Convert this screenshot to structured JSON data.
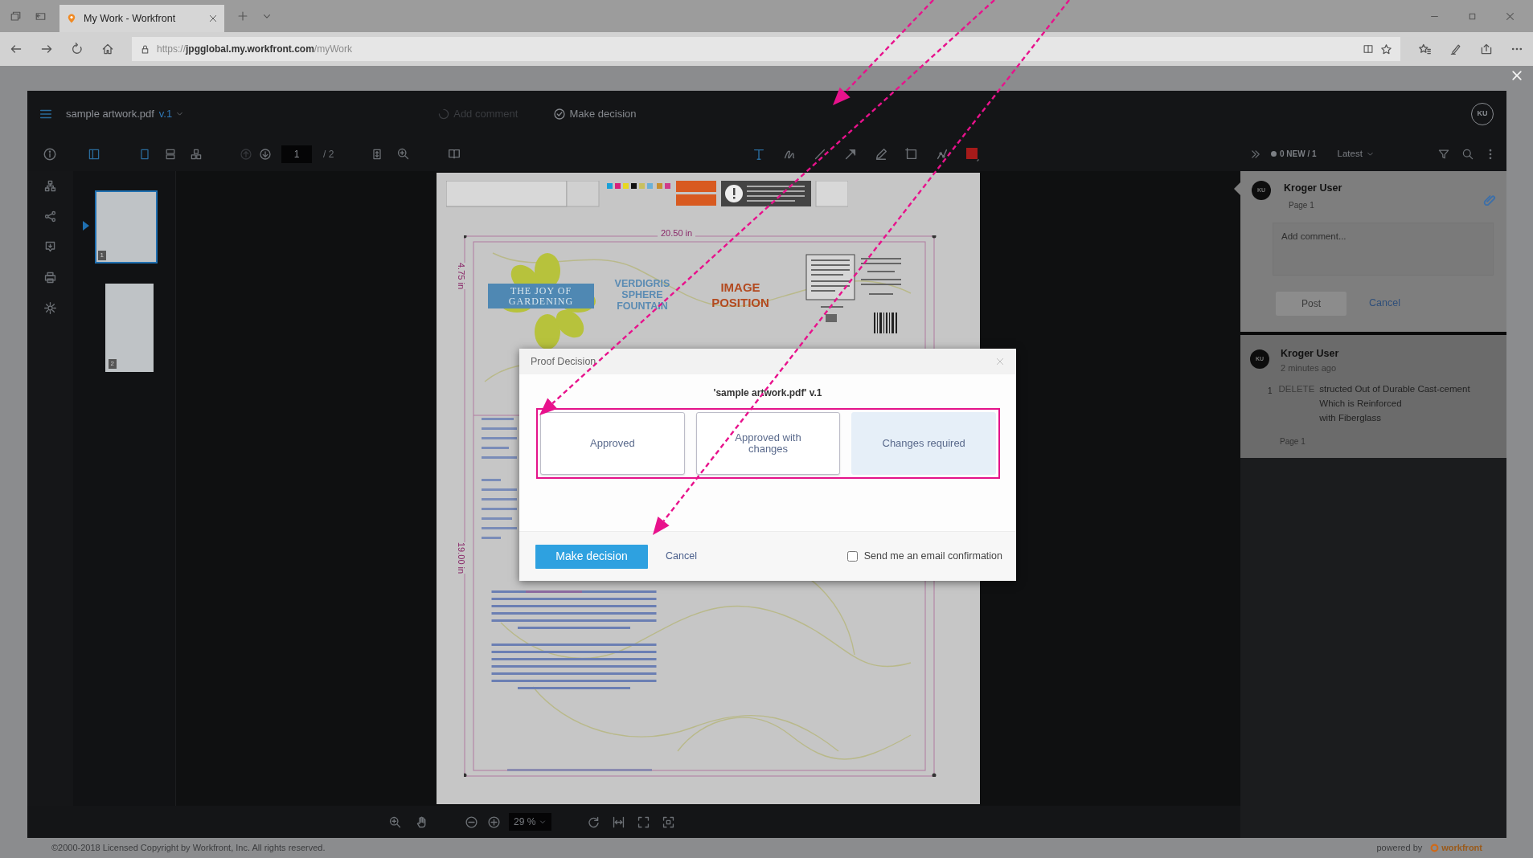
{
  "browser": {
    "tabs": [
      {
        "title": "My Work - Workfront",
        "selected": true
      }
    ],
    "address": "https://**jpgglobal.my.workfront.com**/myWork"
  },
  "viewer": {
    "file_name": "sample artwork.pdf",
    "version": "v.1",
    "header_actions": [
      {
        "kind": "add-comment",
        "label": "Add comment",
        "disabled": true
      },
      {
        "kind": "make-decision",
        "label": "Make decision",
        "disabled": false
      }
    ],
    "avatar": "KU",
    "page_input": "1",
    "page_total": "/ 2",
    "thumbnails": [
      {
        "number": "1",
        "selected": true
      },
      {
        "number": "2",
        "selected": false
      }
    ],
    "document": {
      "width_label": "20.50 in",
      "height_label": "4.75 in",
      "length_label": "19.00 in",
      "brand_lines": [
        "THE JOY OF",
        "GARDENING"
      ],
      "product_lines": [
        "VERDIGRIS",
        "SPHERE",
        "FOUNTAIN"
      ],
      "image_lines": [
        "IMAGE",
        "POSITION"
      ]
    },
    "zoom": "29 %"
  },
  "comments_panel": {
    "new_count": "0 NEW / 1",
    "sort": "Latest",
    "draft": {
      "author": "Kroger User",
      "avatar": "KU",
      "page": "Page 1",
      "placeholder": "Add comment...",
      "post": "Post",
      "post_disabled": true,
      "cancel": "Cancel"
    },
    "comments": [
      {
        "author": "Kroger User",
        "avatar": "KU",
        "time": "2 minutes ago",
        "number": "1",
        "deleted": "DELETE",
        "text": "structed Out of Durable Cast-cement\nWhich is Reinforced\nwith Fiberglass",
        "page": "Page 1"
      }
    ]
  },
  "dialog": {
    "title": "Proof Decision",
    "subject": "'sample artwork.pdf' v.1",
    "options": [
      {
        "label": "Approved",
        "selected": false
      },
      {
        "label": "Approved with changes",
        "selected": false
      },
      {
        "label": "Changes required",
        "selected": true
      }
    ],
    "primary": "Make decision",
    "cancel": "Cancel",
    "email_confirmation": {
      "label": "Send me an email confirmation",
      "checked": false
    }
  },
  "footer": {
    "copyright": "©2000-2018 Licensed Copyright by Workfront, Inc. All rights reserved.",
    "powered_by": "powered by",
    "brand": "workfront"
  }
}
